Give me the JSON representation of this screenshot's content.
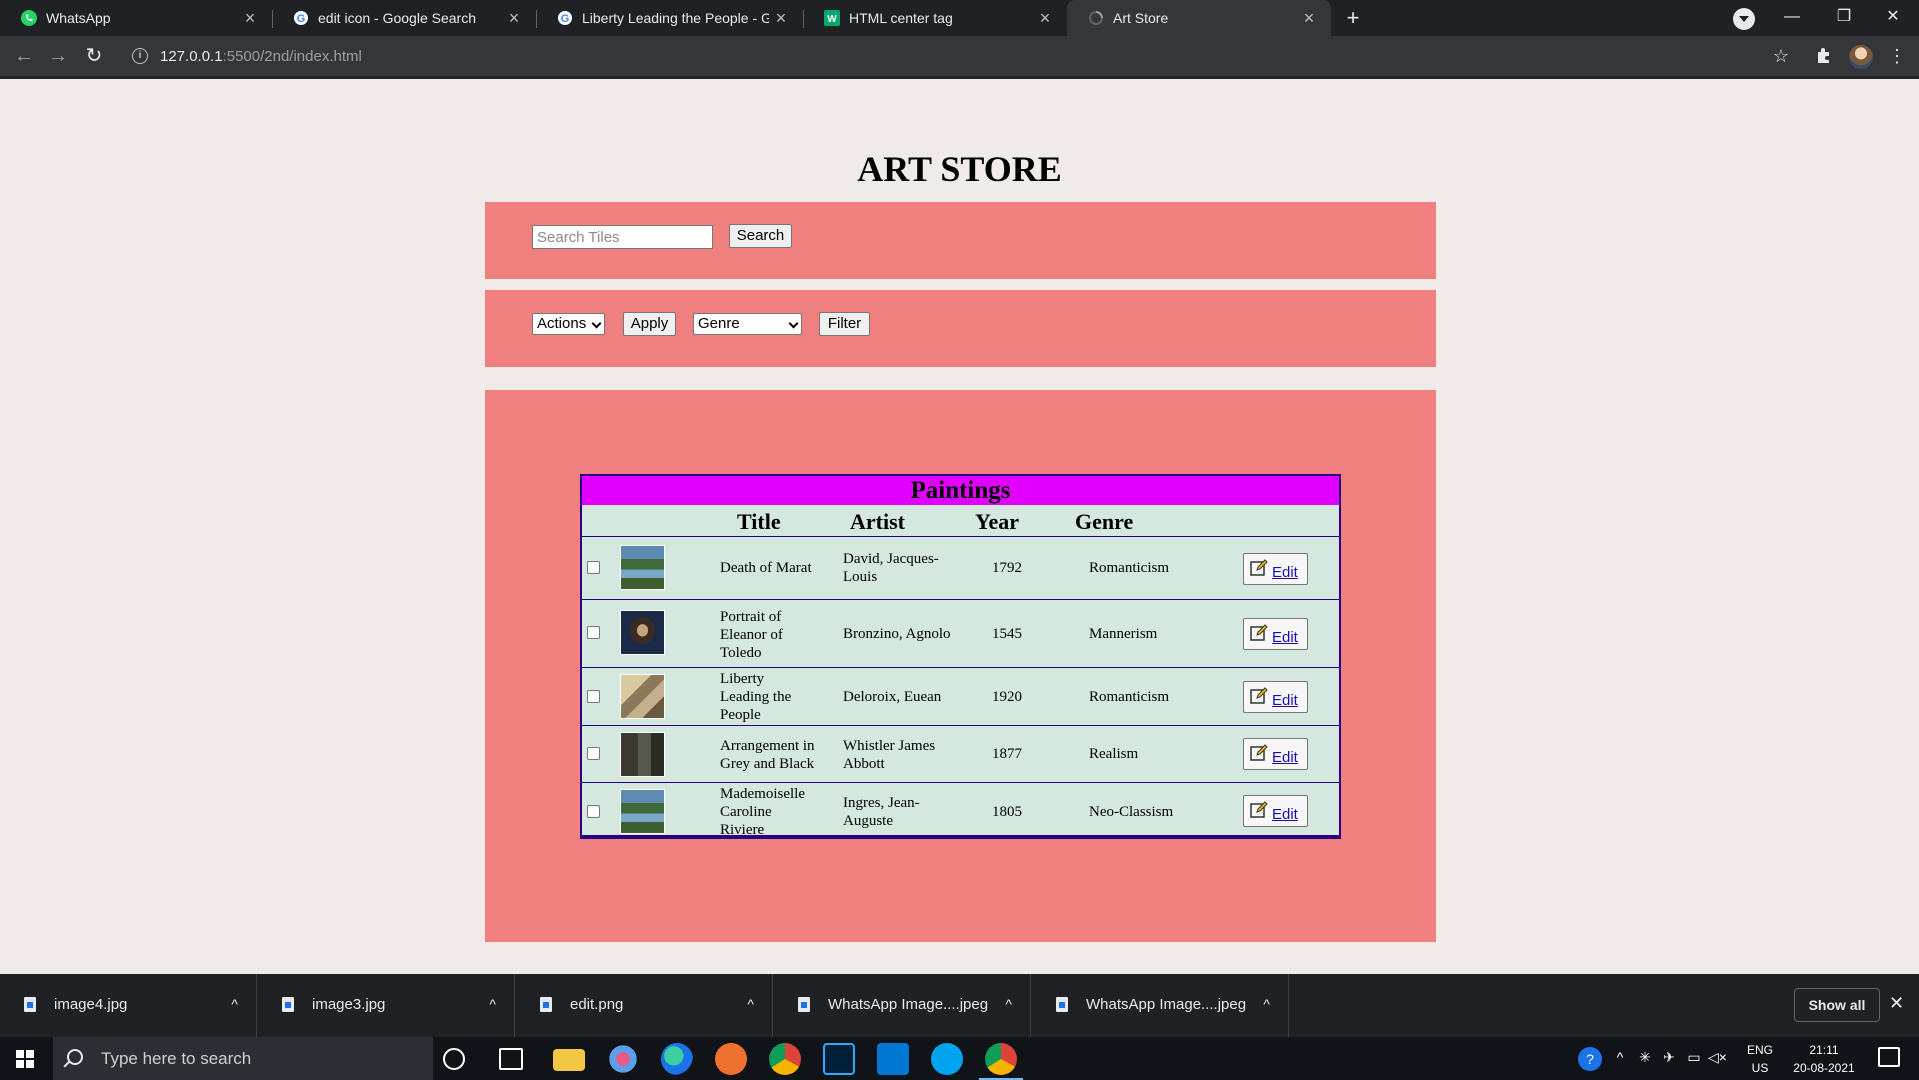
{
  "browser": {
    "tabs": [
      {
        "title": "WhatsApp",
        "icon": "whatsapp-icon"
      },
      {
        "title": "edit icon - Google Search",
        "icon": "google-icon"
      },
      {
        "title": "Liberty Leading the People - Goo",
        "icon": "google-icon"
      },
      {
        "title": "HTML center tag",
        "icon": "w3schools-icon"
      },
      {
        "title": "Art Store",
        "icon": "loading-icon"
      }
    ],
    "url_host": "127.0.0.1",
    "url_path": ":5500/2nd/index.html"
  },
  "page": {
    "title": "ART STORE",
    "search": {
      "placeholder": "Search Tiles",
      "button": "Search"
    },
    "filters": {
      "actions": "Actions",
      "apply": "Apply",
      "genre": "Genre",
      "filter": "Filter"
    },
    "table": {
      "caption": "Paintings",
      "headers": {
        "title": "Title",
        "artist": "Artist",
        "year": "Year",
        "genre": "Genre"
      },
      "edit_label": "Edit",
      "rows": [
        {
          "title": "Death of Marat",
          "artist": "David, Jacques-Louis",
          "year": "1792",
          "genre": "Romanticism"
        },
        {
          "title": "Portrait of Eleanor of Toledo",
          "artist": "Bronzino, Agnolo",
          "year": "1545",
          "genre": "Mannerism"
        },
        {
          "title": "Liberty Leading the People",
          "artist": "Deloroix, Euean",
          "year": "1920",
          "genre": "Romanticism"
        },
        {
          "title": "Arrangement in Grey and Black",
          "artist": "Whistler James Abbott",
          "year": "1877",
          "genre": "Realism"
        },
        {
          "title": "Mademoiselle Caroline Riviere",
          "artist": "Ingres, Jean-Auguste",
          "year": "1805",
          "genre": "Neo-Classism"
        }
      ]
    }
  },
  "downloads": {
    "items": [
      "image4.jpg",
      "image3.jpg",
      "edit.png",
      "WhatsApp Image....jpeg",
      "WhatsApp Image....jpeg"
    ],
    "show_all": "Show all"
  },
  "taskbar": {
    "search_placeholder": "Type here to search",
    "lang": "ENG",
    "region": "US",
    "time": "21:11",
    "date": "20-08-2021"
  },
  "colors": {
    "panel": "#f08080",
    "caption": "#e100ff",
    "table_bg": "#d4e8e0",
    "page_bg": "#f0ebe8"
  }
}
